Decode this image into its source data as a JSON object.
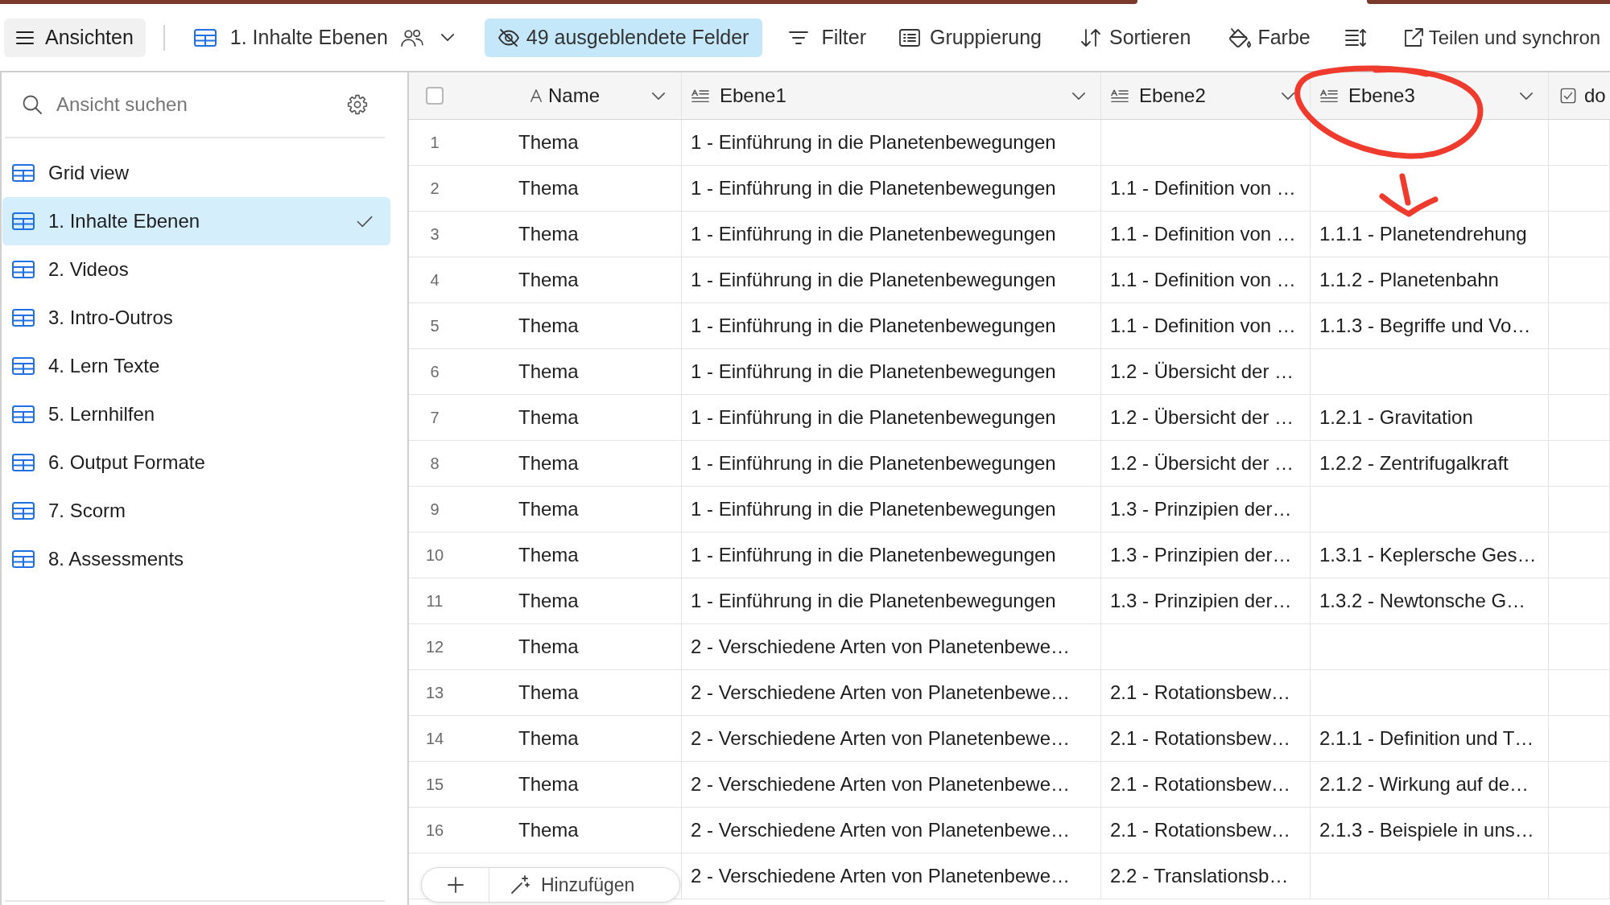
{
  "toolbar": {
    "views_button": {
      "label": "Ansichten"
    },
    "current_view": {
      "label": "1. Inhalte Ebenen"
    },
    "hidden_fields": {
      "label": "49 ausgeblendete Felder",
      "active": true
    },
    "actions": [
      {
        "kind": "filter",
        "label": "Filter"
      },
      {
        "kind": "group",
        "label": "Gruppierung"
      },
      {
        "kind": "sort",
        "label": "Sortieren"
      },
      {
        "kind": "color",
        "label": "Farbe"
      },
      {
        "kind": "row_height"
      },
      {
        "kind": "share",
        "label": "Teilen und synchron"
      }
    ]
  },
  "sidebar": {
    "search": {
      "placeholder": "Ansicht suchen"
    },
    "items": [
      {
        "label": "Grid view",
        "selected": false
      },
      {
        "label": "1. Inhalte Ebenen",
        "selected": true
      },
      {
        "label": "2. Videos",
        "selected": false
      },
      {
        "label": "3. Intro-Outros",
        "selected": false
      },
      {
        "label": "4. Lern Texte",
        "selected": false
      },
      {
        "label": "5. Lernhilfen",
        "selected": false
      },
      {
        "label": "6. Output Formate",
        "selected": false
      },
      {
        "label": "7. Scorm",
        "selected": false
      },
      {
        "label": "8. Assessments",
        "selected": false
      }
    ]
  },
  "table": {
    "select_all": {
      "checked": false
    },
    "columns": [
      {
        "kind": "name",
        "label": "Name"
      },
      {
        "kind": "long_text",
        "label": "Ebene1"
      },
      {
        "kind": "long_text",
        "label": "Ebene2"
      },
      {
        "kind": "long_text",
        "label": "Ebene3"
      },
      {
        "kind": "checkbox",
        "label": "do"
      }
    ],
    "rows": [
      {
        "number": "1",
        "cells": [
          "Thema",
          "1 - Einführung in die Planetenbewegungen",
          null,
          null
        ]
      },
      {
        "number": "2",
        "cells": [
          "Thema",
          "1 - Einführung in die Planetenbewegungen",
          "1.1 - Definition von …",
          null
        ]
      },
      {
        "number": "3",
        "cells": [
          "Thema",
          "1 - Einführung in die Planetenbewegungen",
          "1.1 - Definition von …",
          "1.1.1 - Planetendrehung"
        ]
      },
      {
        "number": "4",
        "cells": [
          "Thema",
          "1 - Einführung in die Planetenbewegungen",
          "1.1 - Definition von …",
          "1.1.2 - Planetenbahn"
        ]
      },
      {
        "number": "5",
        "cells": [
          "Thema",
          "1 - Einführung in die Planetenbewegungen",
          "1.1 - Definition von …",
          "1.1.3 - Begriffe und Vo…"
        ]
      },
      {
        "number": "6",
        "cells": [
          "Thema",
          "1 - Einführung in die Planetenbewegungen",
          "1.2 - Übersicht der …",
          null
        ]
      },
      {
        "number": "7",
        "cells": [
          "Thema",
          "1 - Einführung in die Planetenbewegungen",
          "1.2 - Übersicht der …",
          "1.2.1 - Gravitation"
        ]
      },
      {
        "number": "8",
        "cells": [
          "Thema",
          "1 - Einführung in die Planetenbewegungen",
          "1.2 - Übersicht der …",
          "1.2.2 - Zentrifugalkraft"
        ]
      },
      {
        "number": "9",
        "cells": [
          "Thema",
          "1 - Einführung in die Planetenbewegungen",
          "1.3 - Prinzipien der…",
          null
        ]
      },
      {
        "number": "10",
        "cells": [
          "Thema",
          "1 - Einführung in die Planetenbewegungen",
          "1.3 - Prinzipien der…",
          "1.3.1 - Keplersche Ges…"
        ]
      },
      {
        "number": "11",
        "cells": [
          "Thema",
          "1 - Einführung in die Planetenbewegungen",
          "1.3 - Prinzipien der…",
          "1.3.2 - Newtonsche G…"
        ]
      },
      {
        "number": "12",
        "cells": [
          "Thema",
          "2 - Verschiedene Arten von Planetenbewe…",
          null,
          null
        ]
      },
      {
        "number": "13",
        "cells": [
          "Thema",
          "2 - Verschiedene Arten von Planetenbewe…",
          "2.1 - Rotationsbew…",
          null
        ]
      },
      {
        "number": "14",
        "cells": [
          "Thema",
          "2 - Verschiedene Arten von Planetenbewe…",
          "2.1 - Rotationsbew…",
          "2.1.1 - Definition und T…"
        ]
      },
      {
        "number": "15",
        "cells": [
          "Thema",
          "2 - Verschiedene Arten von Planetenbewe…",
          "2.1 - Rotationsbew…",
          "2.1.2 - Wirkung auf de…"
        ]
      },
      {
        "number": "16",
        "cells": [
          "Thema",
          "2 - Verschiedene Arten von Planetenbewe…",
          "2.1 - Rotationsbew…",
          "2.1.3 - Beispiele in uns…"
        ]
      },
      {
        "cells": [
          null,
          "2 - Verschiedene Arten von Planetenbewe…",
          "2.2 - Translationsb…",
          null
        ]
      }
    ]
  },
  "add_bar": {
    "label": "Hinzufügen"
  },
  "annotation": {
    "kind": "circle_with_arrow"
  }
}
